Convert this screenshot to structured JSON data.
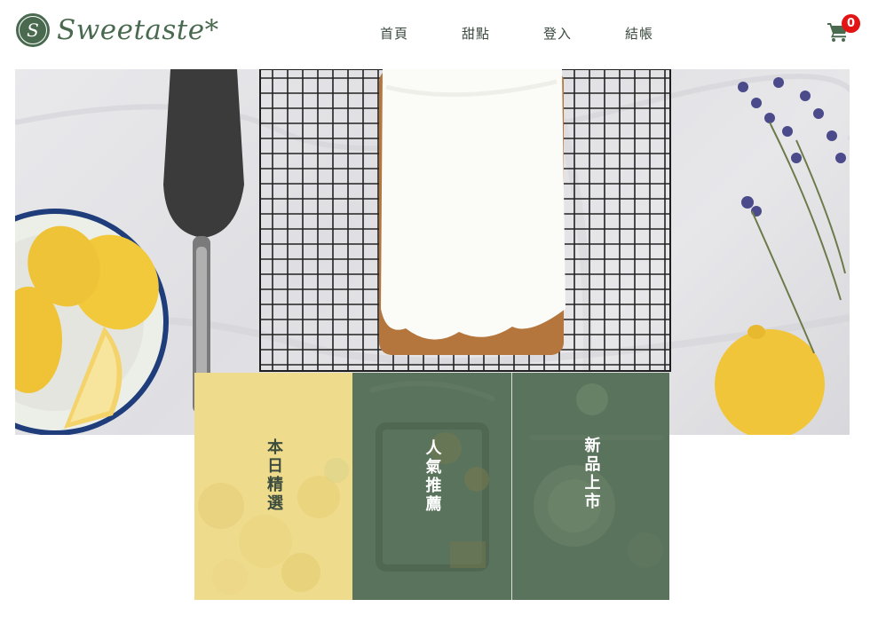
{
  "brand": {
    "logo_letter": "S",
    "name": "Sweetaste*"
  },
  "nav": [
    {
      "label": "首頁"
    },
    {
      "label": "甜點"
    },
    {
      "label": "登入"
    },
    {
      "label": "結帳"
    }
  ],
  "cart": {
    "icon": "shopping-cart-icon",
    "count": "0",
    "badge_color": "#e31414"
  },
  "hero": {
    "image": "lemon-loaf-cake-photo"
  },
  "categories": [
    {
      "label": "本日精選",
      "color": "#efdb8c"
    },
    {
      "label": "人氣推薦",
      "color": "#5a735c"
    },
    {
      "label": "新品上市",
      "color": "#5a735c"
    }
  ],
  "colors": {
    "brand_green": "#4a6a50",
    "text_dark": "#3c4a3f"
  }
}
